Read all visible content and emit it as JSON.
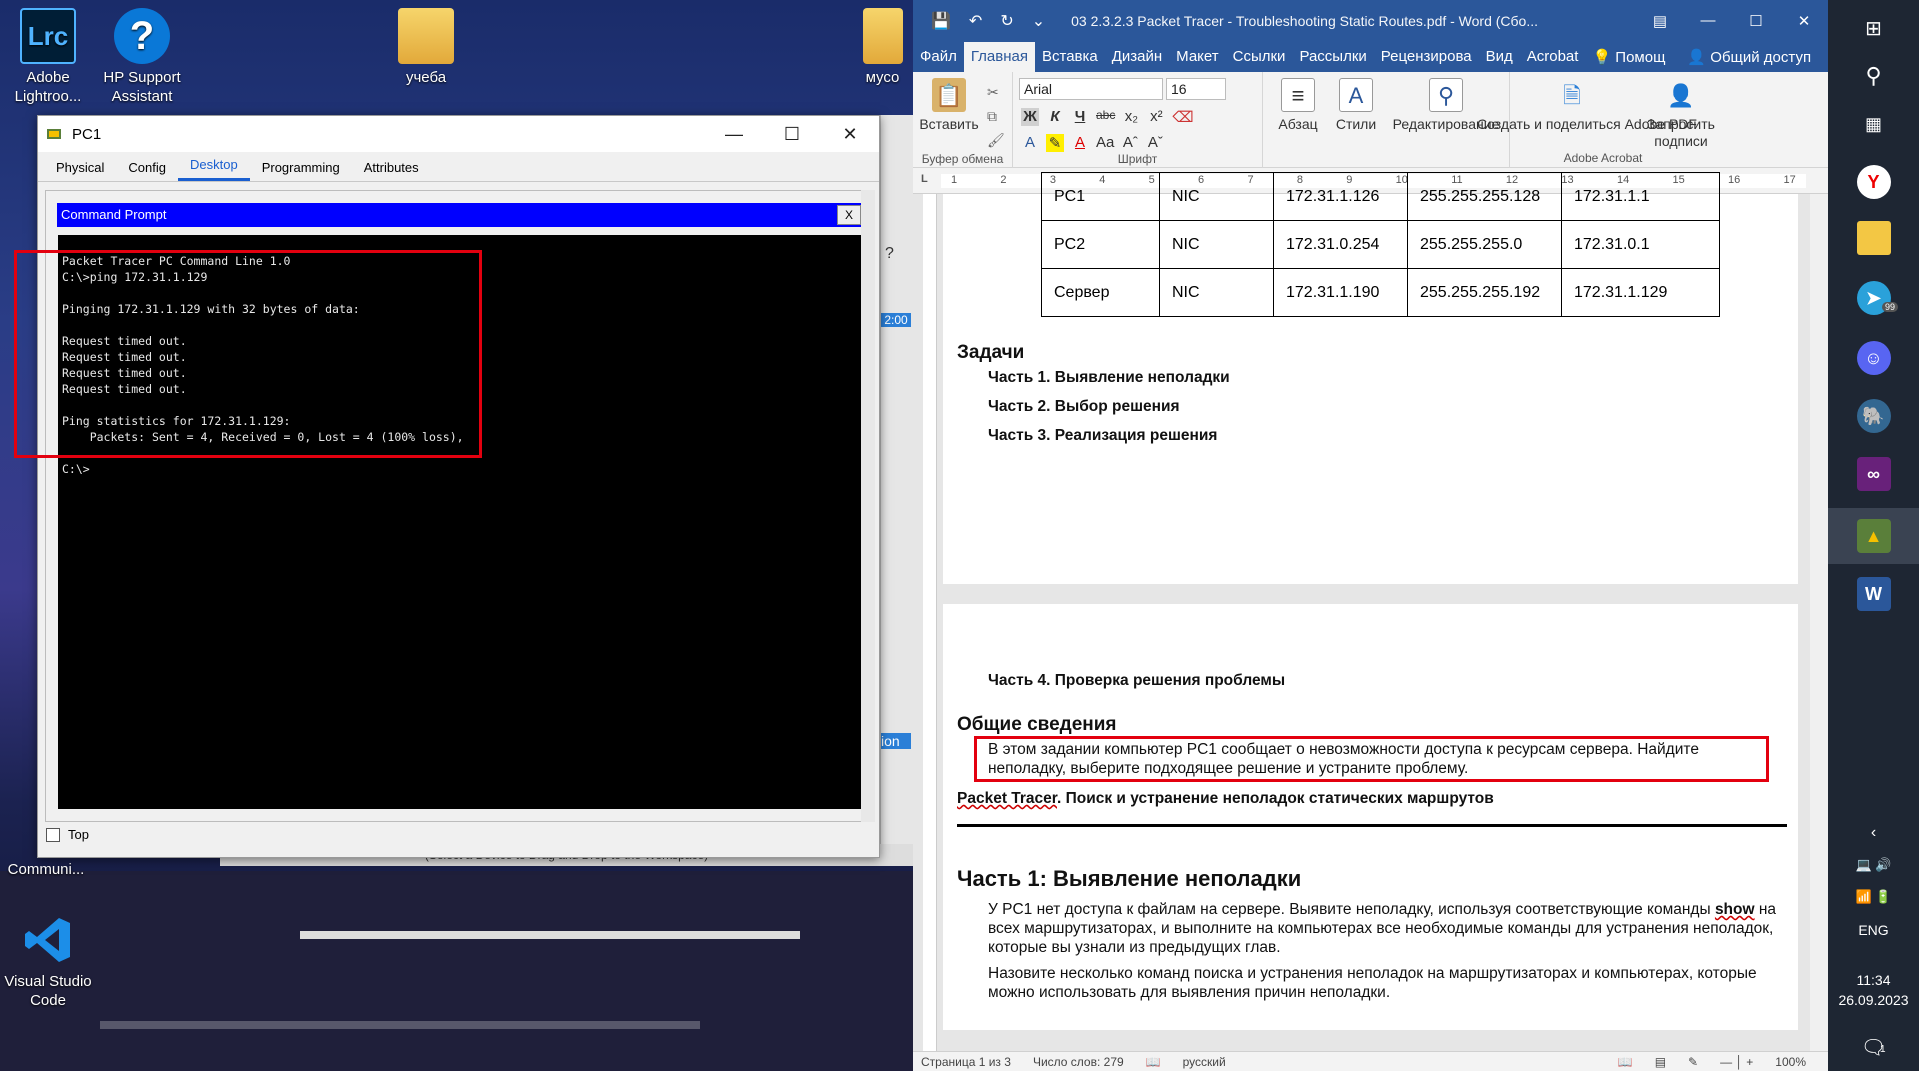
{
  "desktop": {
    "icons": [
      {
        "label": "Adobe Lightroo...",
        "icon": "lightroom-icon",
        "glyph": "Lrc"
      },
      {
        "label": "HP Support Assistant",
        "icon": "hp-support-icon",
        "glyph": "?"
      },
      {
        "label": "учеба",
        "icon": "folder-icon"
      },
      {
        "label": "мусо",
        "icon": "folder-icon"
      },
      {
        "label": "Communi...",
        "icon": "app-icon"
      },
      {
        "label": "Visual Studio Code",
        "icon": "vscode-icon"
      }
    ],
    "bg_hint": "(Select a Device to Drag and Drop to the Workspace)"
  },
  "packet_tracer": {
    "title": "PC1",
    "tabs": [
      "Physical",
      "Config",
      "Desktop",
      "Programming",
      "Attributes"
    ],
    "active_tab": "Desktop",
    "cmd_title": "Command Prompt",
    "cmd_close": "X",
    "cmd_output": "Packet Tracer PC Command Line 1.0\nC:\\>ping 172.31.1.129\n\nPinging 172.31.1.129 with 32 bytes of data:\n\nRequest timed out.\nRequest timed out.\nRequest timed out.\nRequest timed out.\n\nPing statistics for 172.31.1.129:\n    Packets: Sent = 4, Received = 0, Lost = 4 (100% loss),\n\nC:\\>",
    "top_checkbox_label": "Top",
    "side_labels": {
      "help": "?",
      "time": "2:00",
      "tab": "ion"
    }
  },
  "word": {
    "title": "03 2.3.2.3 Packet Tracer - Troubleshooting Static Routes.pdf - Word (Сбо...",
    "menu": [
      "Файл",
      "Главная",
      "Вставка",
      "Дизайн",
      "Макет",
      "Ссылки",
      "Рассылки",
      "Рецензирова",
      "Вид",
      "Acrobat",
      "Помощ",
      "Общий доступ"
    ],
    "active_menu": "Главная",
    "ribbon": {
      "paste": "Вставить",
      "clipboard_group": "Буфер обмена",
      "font_name": "Arial",
      "font_size": "16",
      "font_group": "Шрифт",
      "paragraph": "Абзац",
      "styles": "Стили",
      "editing": "Редактирование",
      "create_share": "Создать и поделиться Adobe PDF",
      "request_sign": "Запросить подписи",
      "acrobat_group": "Adobe Acrobat",
      "bold": "Ж",
      "italic": "К",
      "underline": "Ч",
      "strike": "abc",
      "subscript": "x₂",
      "superscript": "x²"
    },
    "ruler_ticks": [
      "1",
      "2",
      "3",
      "4",
      "5",
      "6",
      "7",
      "8",
      "9",
      "10",
      "11",
      "12",
      "13",
      "14",
      "15",
      "16",
      "17"
    ],
    "table_rows": [
      [
        "PC1",
        "NIC",
        "172.31.1.126",
        "255.255.255.128",
        "172.31.1.1"
      ],
      [
        "PC2",
        "NIC",
        "172.31.0.254",
        "255.255.255.0",
        "172.31.0.1"
      ],
      [
        "Сервер",
        "NIC",
        "172.31.1.190",
        "255.255.255.192",
        "172.31.1.129"
      ]
    ],
    "tasks_heading": "Задачи",
    "parts": [
      "Часть 1. Выявление неполадки",
      "Часть 2. Выбор решения",
      "Часть 3. Реализация решения"
    ],
    "part4": "Часть 4. Проверка решения проблемы",
    "general_heading": "Общие сведения",
    "general_text": "В этом задании компьютер PC1 сообщает о невозможности доступа к ресурсам сервера. Найдите неполадку, выберите подходящее решение и устраните проблему.",
    "pt_header_1": "Packet Tracer",
    "pt_header_2": ". Поиск и устранение неполадок статических маршрутов",
    "part1_heading": "Часть 1: Выявление неполадки",
    "part1_p1_a": "У PC1 нет доступа к файлам на сервере. Выявите неполадку, используя соответствующие команды ",
    "part1_p1_show": "show",
    "part1_p1_b": " на всех маршрутизаторах, и выполните на компьютерах все необходимые команды для устранения неполадок, которые вы узнали из предыдущих глав.",
    "part1_p2": "Назовите несколько команд поиска и устранения неполадок на маршрутизаторах и компьютерах, которые можно использовать для выявления причин неполадки.",
    "status": {
      "page": "Страница 1 из 3",
      "words": "Число слов: 279",
      "lang": "русский",
      "zoom": "100%"
    }
  },
  "taskbar": {
    "lang": "ENG",
    "time": "11:34",
    "date": "26.09.2023",
    "telegram_badge": "99",
    "notif_badge": "1"
  }
}
